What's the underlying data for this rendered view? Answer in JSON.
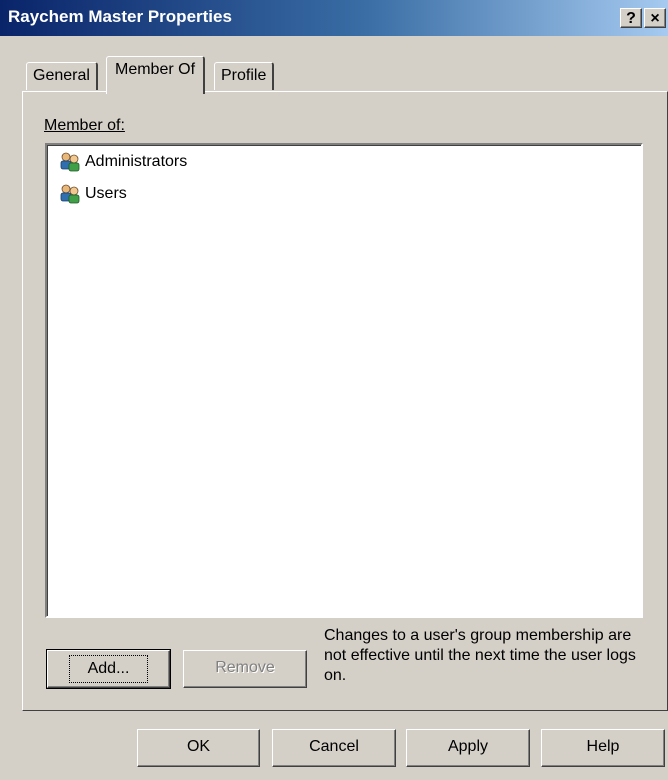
{
  "window": {
    "title": "Raychem Master Properties",
    "help_button": "?",
    "close_button": "×"
  },
  "tabs": [
    {
      "label": "General",
      "selected": false
    },
    {
      "label": "Member Of",
      "selected": true
    },
    {
      "label": "Profile",
      "selected": false
    }
  ],
  "member_of": {
    "label": "Member of:",
    "groups": [
      {
        "name": "Administrators",
        "icon": "group-icon"
      },
      {
        "name": "Users",
        "icon": "group-icon"
      }
    ]
  },
  "actions": {
    "add_label": "Add...",
    "remove_label": "Remove",
    "remove_enabled": false,
    "note": "Changes to a user's group membership are not effective until the next time the user logs on."
  },
  "footer": {
    "ok_label": "OK",
    "cancel_label": "Cancel",
    "apply_label": "Apply",
    "help_label": "Help"
  },
  "colors": {
    "title_bar_start": "#0a246a",
    "title_bar_end": "#a6caf0",
    "face": "#d4d0c8"
  }
}
